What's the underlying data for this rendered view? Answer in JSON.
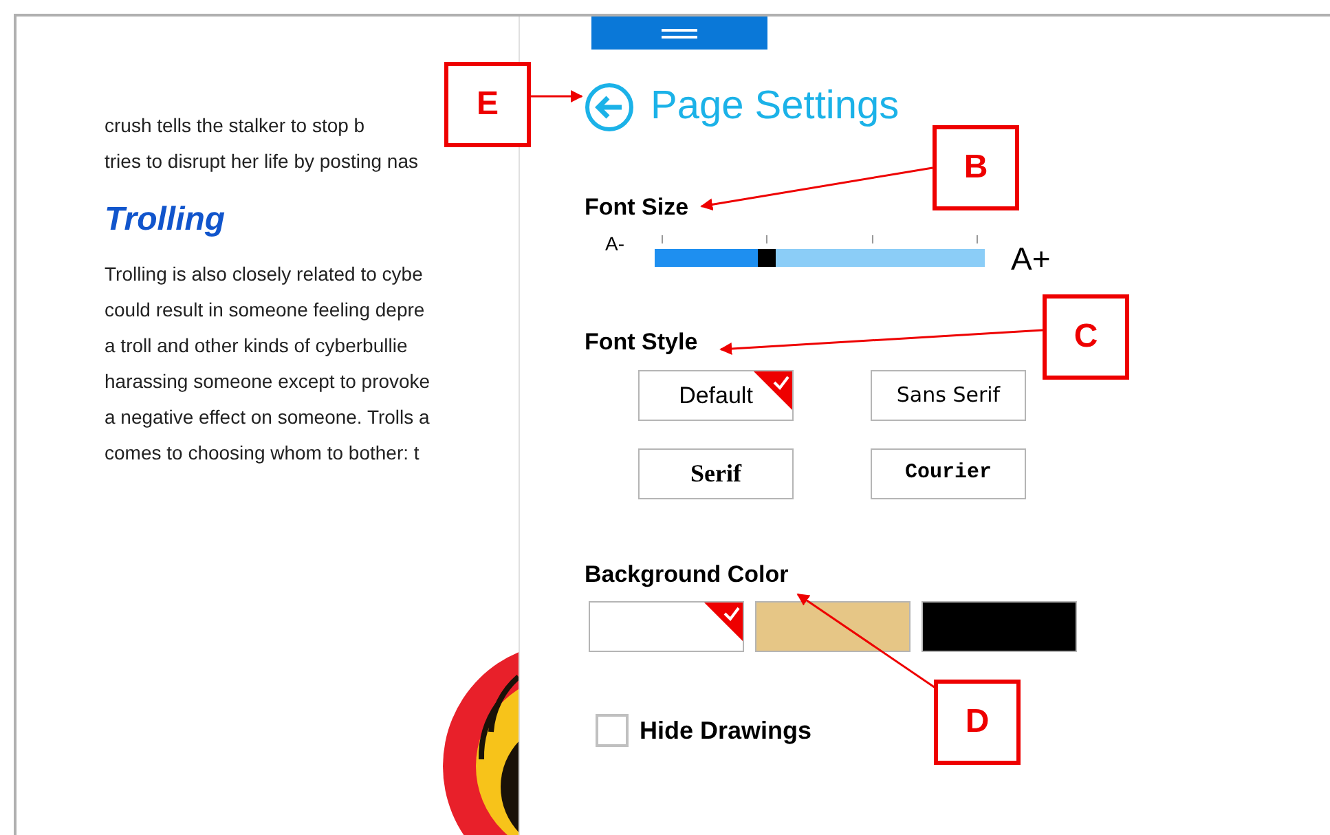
{
  "reader": {
    "paragraph_1": [
      "crush tells the stalker to stop b",
      "tries to disrupt her life by posting nas"
    ],
    "heading": "Trolling",
    "paragraph_2": [
      "Trolling is also closely related to cybe",
      "could result in someone feeling depre",
      "a troll and other kinds of cyberbullie",
      "harassing someone except to provoke",
      "a negative effect on someone. Trolls a",
      "comes to choosing whom to bother: t"
    ]
  },
  "panel": {
    "title": "Page Settings",
    "font_size": {
      "label": "Font Size",
      "min_label": "A-",
      "max_label": "A+",
      "level": 0.33
    },
    "font_style": {
      "label": "Font Style",
      "options": [
        {
          "label": "Default",
          "kind": "default",
          "selected": true
        },
        {
          "label": "Sans Serif",
          "kind": "sans",
          "selected": false
        },
        {
          "label": "Serif",
          "kind": "serif",
          "selected": false
        },
        {
          "label": "Courier",
          "kind": "mono",
          "selected": false
        }
      ]
    },
    "background_color": {
      "label": "Background Color",
      "swatches": [
        {
          "color": "#ffffff",
          "selected": true
        },
        {
          "color": "#e6c686",
          "selected": false
        },
        {
          "color": "#000000",
          "selected": false
        }
      ]
    },
    "hide_drawings": {
      "label": "Hide Drawings",
      "checked": false
    }
  },
  "annotations": [
    {
      "letter": "E"
    },
    {
      "letter": "B"
    },
    {
      "letter": "C"
    },
    {
      "letter": "D"
    }
  ]
}
